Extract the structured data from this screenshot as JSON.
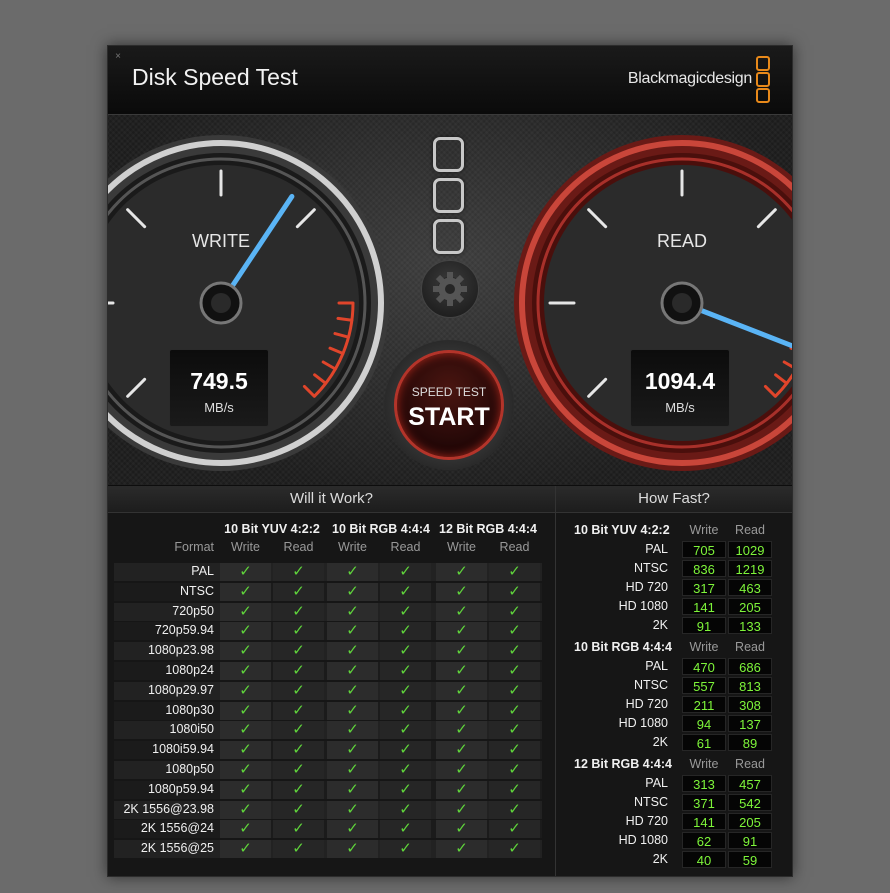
{
  "window": {
    "title": "Disk Speed Test",
    "brand": "Blackmagicdesign",
    "close_glyph": "×"
  },
  "gauges": {
    "write": {
      "label": "WRITE",
      "value": "749.5",
      "unit": "MB/s"
    },
    "read": {
      "label": "READ",
      "value": "1094.4",
      "unit": "MB/s"
    }
  },
  "start_button": {
    "small_label": "SPEED TEST",
    "big_label": "START"
  },
  "will_it_work": {
    "title": "Will it Work?",
    "format_header": "Format",
    "groups": [
      "10 Bit YUV 4:2:2",
      "10 Bit RGB 4:4:4",
      "12 Bit RGB 4:4:4"
    ],
    "subheaders": [
      "Write",
      "Read",
      "Write",
      "Read",
      "Write",
      "Read"
    ],
    "check_glyph": "✓",
    "formats": [
      "PAL",
      "NTSC",
      "720p50",
      "720p59.94",
      "1080p23.98",
      "1080p24",
      "1080p29.97",
      "1080p30",
      "1080i50",
      "1080i59.94",
      "1080p50",
      "1080p59.94",
      "2K 1556@23.98",
      "2K 1556@24",
      "2K 1556@25"
    ]
  },
  "how_fast": {
    "title": "How Fast?",
    "groups": [
      {
        "name": "10 Bit YUV 4:2:2",
        "write_label": "Write",
        "read_label": "Read",
        "rows": [
          {
            "format": "PAL",
            "write": "705",
            "read": "1029"
          },
          {
            "format": "NTSC",
            "write": "836",
            "read": "1219"
          },
          {
            "format": "HD 720",
            "write": "317",
            "read": "463"
          },
          {
            "format": "HD 1080",
            "write": "141",
            "read": "205"
          },
          {
            "format": "2K",
            "write": "91",
            "read": "133"
          }
        ]
      },
      {
        "name": "10 Bit RGB 4:4:4",
        "write_label": "Write",
        "read_label": "Read",
        "rows": [
          {
            "format": "PAL",
            "write": "470",
            "read": "686"
          },
          {
            "format": "NTSC",
            "write": "557",
            "read": "813"
          },
          {
            "format": "HD 720",
            "write": "211",
            "read": "308"
          },
          {
            "format": "HD 1080",
            "write": "94",
            "read": "137"
          },
          {
            "format": "2K",
            "write": "61",
            "read": "89"
          }
        ]
      },
      {
        "name": "12 Bit RGB 4:4:4",
        "write_label": "Write",
        "read_label": "Read",
        "rows": [
          {
            "format": "PAL",
            "write": "313",
            "read": "457"
          },
          {
            "format": "NTSC",
            "write": "371",
            "read": "542"
          },
          {
            "format": "HD 720",
            "write": "141",
            "read": "205"
          },
          {
            "format": "HD 1080",
            "write": "62",
            "read": "91"
          },
          {
            "format": "2K",
            "write": "40",
            "read": "59"
          }
        ]
      }
    ]
  },
  "colors": {
    "accent": "#e8891a",
    "check": "#5fd33b",
    "value_green": "#7ef53a",
    "needle": "#5ab4f5",
    "read_ring": "#a8302a"
  }
}
